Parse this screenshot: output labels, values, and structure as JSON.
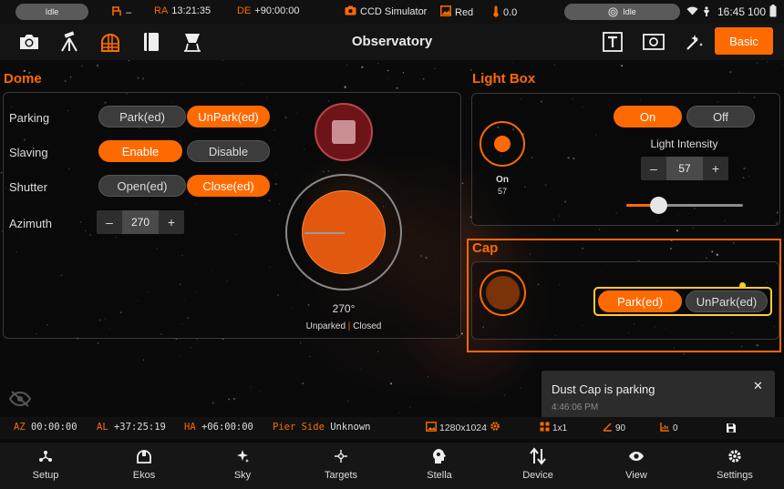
{
  "statusbar": {
    "left_pill": "Idle",
    "tracking_dash": "–",
    "ra_label": "RA",
    "ra_value": "13:21:35",
    "de_label": "DE",
    "de_value": "+90:00:00",
    "camera": "CCD Simulator",
    "filter": "Red",
    "temperature": "0.0",
    "right_pill": "Idle",
    "time": "16:45",
    "battery": "100"
  },
  "toolbar": {
    "title": "Observatory",
    "mode_button": "Basic"
  },
  "dome": {
    "title": "Dome",
    "parking": {
      "label": "Parking",
      "park": "Park(ed)",
      "unpark": "UnPark(ed)"
    },
    "slaving": {
      "label": "Slaving",
      "enable": "Enable",
      "disable": "Disable"
    },
    "shutter": {
      "label": "Shutter",
      "open": "Open(ed)",
      "close": "Close(ed)"
    },
    "azimuth": {
      "label": "Azimuth",
      "minus": "–",
      "value": "270",
      "plus": "+"
    },
    "azimuth_display": "270°",
    "status_parked": "Unparked",
    "status_sep": "|",
    "status_shutter": "Closed",
    "azimuth_degrees": 270
  },
  "lightbox": {
    "title": "Light Box",
    "on": "On",
    "off": "Off",
    "indicator_label": "On",
    "indicator_value": "57",
    "intensity_label": "Light Intensity",
    "stepper": {
      "minus": "–",
      "value": "57",
      "plus": "+"
    },
    "slider_fraction": 0.27
  },
  "cap": {
    "title": "Cap",
    "park": "Park(ed)",
    "unpark": "UnPark(ed)"
  },
  "toast": {
    "message": "Dust Cap is parking",
    "time": "4:46:06 PM",
    "close": "✕"
  },
  "infobar": {
    "az_label": "AZ",
    "az_value": "00:00:00",
    "al_label": "AL",
    "al_value": "+37:25:19",
    "ha_label": "HA",
    "ha_value": "+06:00:00",
    "pier_label": "Pier Side",
    "pier_value": "Unknown",
    "resolution": "1280x1024",
    "binning": "1x1",
    "angle": "90",
    "offset": "0"
  },
  "nav": [
    {
      "label": "Setup",
      "icon": "setup-icon"
    },
    {
      "label": "Ekos",
      "icon": "ekos-icon"
    },
    {
      "label": "Sky",
      "icon": "sky-icon"
    },
    {
      "label": "Targets",
      "icon": "targets-icon"
    },
    {
      "label": "Stella",
      "icon": "stella-icon"
    },
    {
      "label": "Device",
      "icon": "device-icon"
    },
    {
      "label": "View",
      "icon": "view-icon"
    },
    {
      "label": "Settings",
      "icon": "settings-icon"
    }
  ],
  "colors": {
    "accent": "#ff6a00",
    "highlight": "#ffcc33",
    "dome_fill": "#e2580e",
    "cap_fill": "#7a3208"
  }
}
